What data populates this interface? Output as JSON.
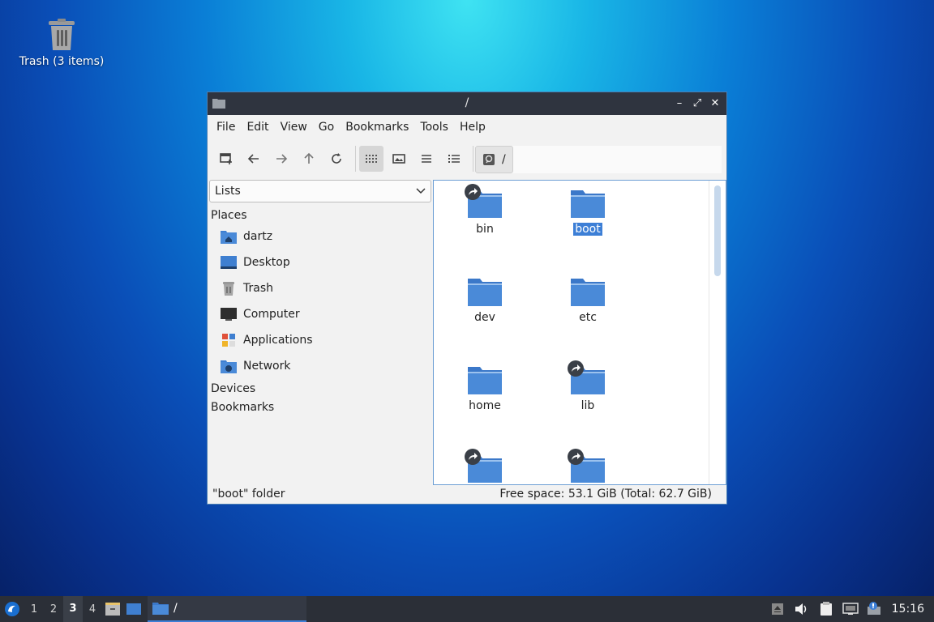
{
  "desktop": {
    "trash_label": "Trash (3 items)"
  },
  "window": {
    "title": "/",
    "menu": [
      "File",
      "Edit",
      "View",
      "Go",
      "Bookmarks",
      "Tools",
      "Help"
    ],
    "path_label": "/",
    "side_combo": "Lists",
    "places_header": "Places",
    "places": [
      {
        "label": "dartz",
        "icon": "home-folder-icon"
      },
      {
        "label": "Desktop",
        "icon": "desktop-icon"
      },
      {
        "label": "Trash",
        "icon": "trash-icon"
      },
      {
        "label": "Computer",
        "icon": "computer-icon"
      },
      {
        "label": "Applications",
        "icon": "applications-icon"
      },
      {
        "label": "Network",
        "icon": "network-folder-icon"
      }
    ],
    "devices_header": "Devices",
    "bookmarks_header": "Bookmarks",
    "items": [
      {
        "label": "bin",
        "link": true,
        "selected": false
      },
      {
        "label": "boot",
        "link": false,
        "selected": true
      },
      {
        "label": "dev",
        "link": false,
        "selected": false
      },
      {
        "label": "etc",
        "link": false,
        "selected": false
      },
      {
        "label": "home",
        "link": false,
        "selected": false
      },
      {
        "label": "lib",
        "link": true,
        "selected": false
      },
      {
        "label": "",
        "link": true,
        "selected": false
      },
      {
        "label": "",
        "link": true,
        "selected": false
      }
    ],
    "status_left": "\"boot\" folder",
    "status_right": "Free space: 53.1 GiB (Total: 62.7 GiB)"
  },
  "taskbar": {
    "workspaces": [
      "1",
      "2",
      "3",
      "4"
    ],
    "current_workspace": "3",
    "task_label": "/",
    "clock": "15:16"
  },
  "colors": {
    "folder": "#4a8ad8",
    "accent": "#3d7fd6",
    "panel": "#2b2f37"
  }
}
